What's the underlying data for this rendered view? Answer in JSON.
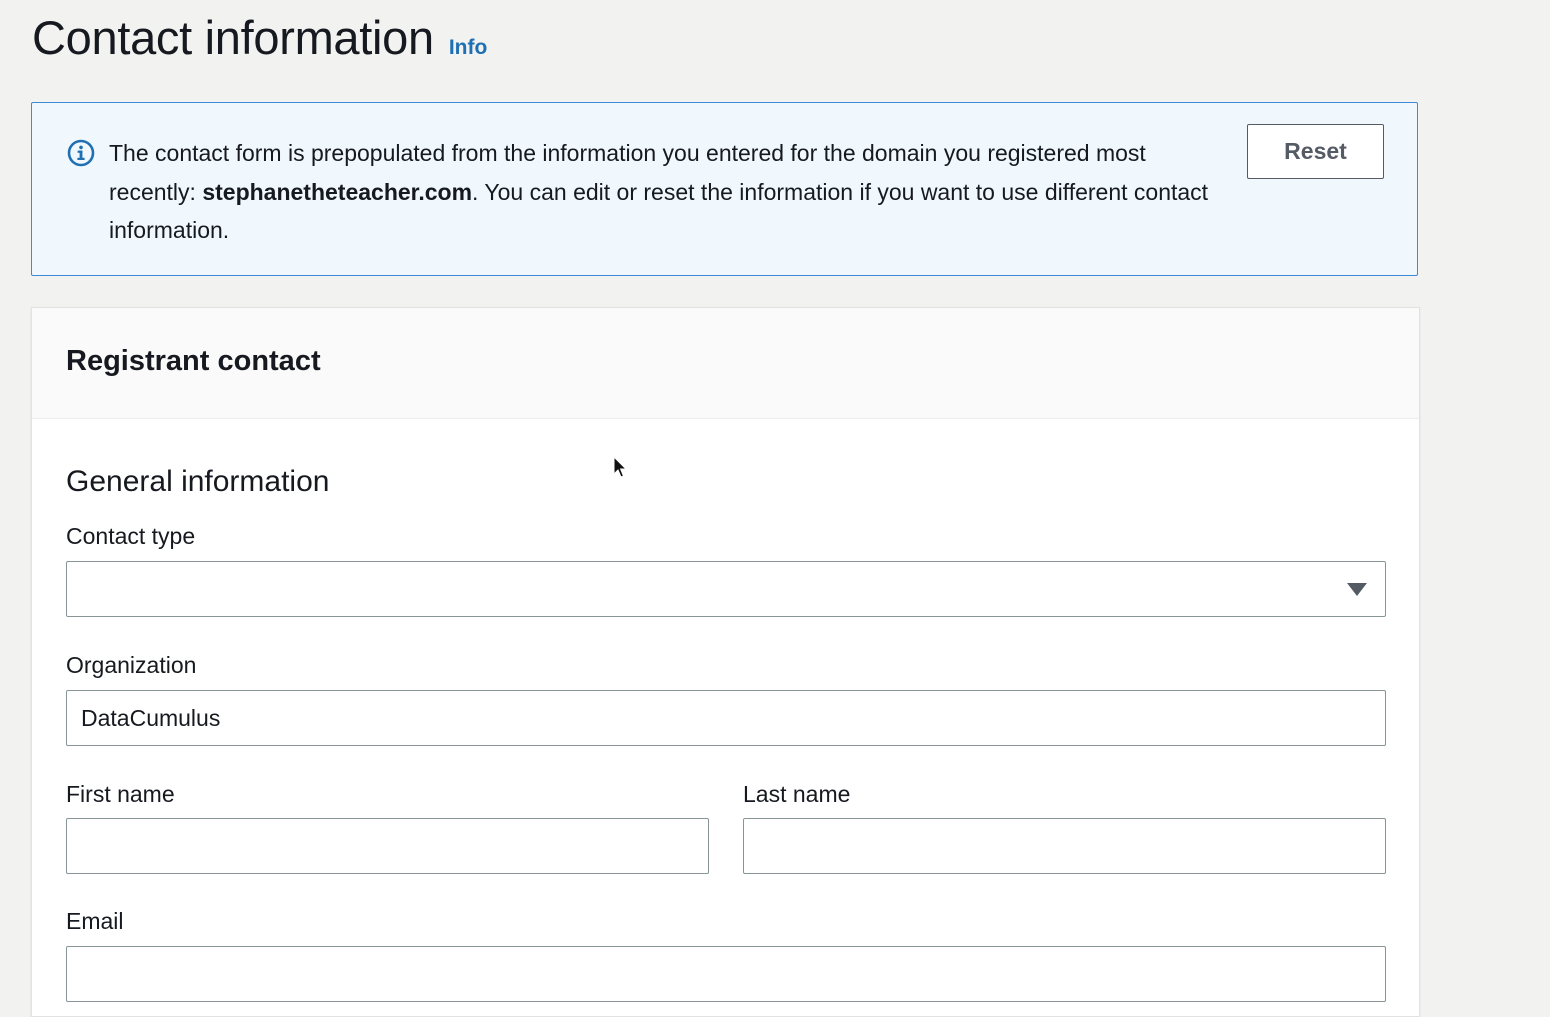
{
  "header": {
    "title": "Contact information",
    "info_link": "Info"
  },
  "alert": {
    "icon": "info-circle-icon",
    "text_before": "The contact form is prepopulated from the information you entered for the domain you registered most recently: ",
    "domain": "stephanetheteacher.com",
    "text_after": ". You can edit or reset the information if you want to use different contact information.",
    "reset_label": "Reset",
    "border_color": "#3f8ad8",
    "background_color": "#f0f8fd"
  },
  "registrant": {
    "title": "Registrant contact",
    "section_title": "General information",
    "contact_type": {
      "label": "Contact type",
      "value": ""
    },
    "organization": {
      "label": "Organization",
      "value": "DataCumulus"
    },
    "first_name": {
      "label": "First name",
      "value": ""
    },
    "last_name": {
      "label": "Last name",
      "value": ""
    },
    "email": {
      "label": "Email",
      "value": ""
    }
  }
}
